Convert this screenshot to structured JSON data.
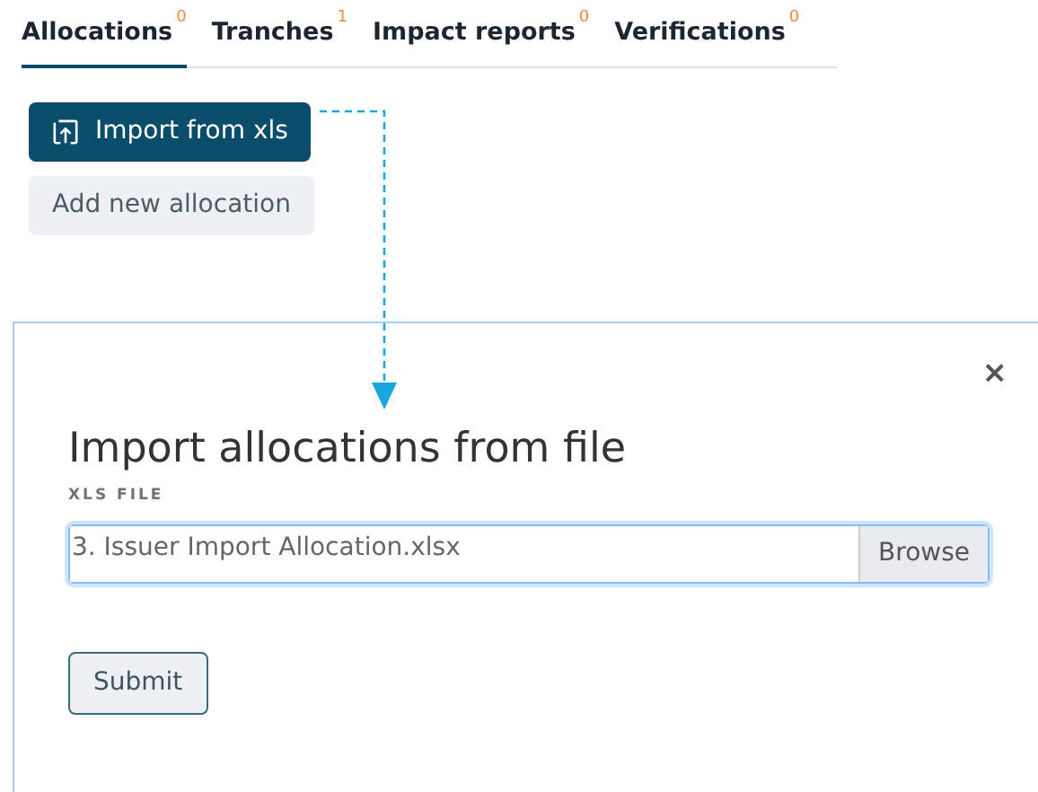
{
  "tabs": [
    {
      "label": "Allocations",
      "count": "0",
      "selected": true
    },
    {
      "label": "Tranches",
      "count": "1",
      "selected": false
    },
    {
      "label": "Impact reports",
      "count": "0",
      "selected": false
    },
    {
      "label": "Verifications",
      "count": "0",
      "selected": false
    }
  ],
  "actions": [
    {
      "label": "Import from xls",
      "kind": "primary"
    },
    {
      "label": "Add new allocation",
      "kind": "secondary"
    }
  ],
  "modal": {
    "title": "Import allocations from file",
    "field_label": "XLS FILE",
    "file_value": "3. Issuer Import Allocation.xlsx",
    "browse_label": "Browse",
    "submit_label": "Submit",
    "close": "×"
  }
}
